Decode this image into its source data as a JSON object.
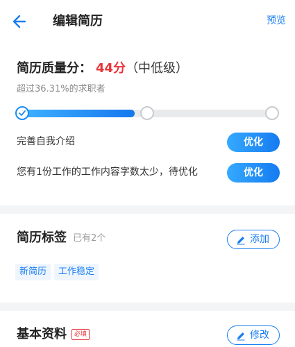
{
  "header": {
    "title": "编辑简历",
    "preview_label": "预览"
  },
  "score": {
    "label": "简历质量分：",
    "value": "44分",
    "level": "（中低级）",
    "exceed_text": "超过36.31%的求职者",
    "progress": 0.45
  },
  "tasks": [
    {
      "text": "完善自我介绍",
      "button": "优化"
    },
    {
      "text": "您有1份工作的工作内容字数太少，待优化",
      "button": "优化"
    }
  ],
  "tags_section": {
    "title": "简历标签",
    "count_text": "已有2个",
    "add_label": "添加",
    "tags": [
      "新简历",
      "工作稳定"
    ]
  },
  "basic_section": {
    "title": "基本资料",
    "required_label": "必填",
    "edit_label": "修改"
  },
  "colors": {
    "accent": "#1a7ef0",
    "score_red": "#e8343a",
    "divider": "#f3f4f6"
  }
}
